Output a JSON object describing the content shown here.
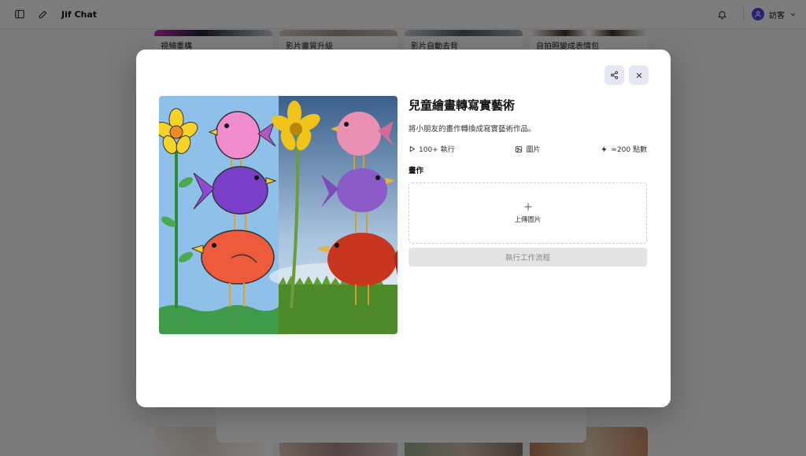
{
  "app": {
    "brand": "Jif Chat",
    "user_name": "訪客"
  },
  "background_cards": [
    "視頻重構",
    "影片畫質升級",
    "影片自動去背",
    "自拍照變成表情包"
  ],
  "modal": {
    "title": "兒童繪畫轉寫實藝術",
    "description": "將小朋友的畫作轉換成寫實藝術作品。",
    "meta": {
      "runs": "100+ 執行",
      "type": "圖片",
      "cost": "≈200 點數"
    },
    "field_label": "畫作",
    "upload_label": "上傳圖片",
    "run_button": "執行工作流程"
  },
  "icons": {
    "sidebar": "sidebar-toggle-icon",
    "new_chat": "edit-icon",
    "bell": "bell-icon",
    "share": "share-icon",
    "close": "close-icon",
    "play": "play-icon",
    "image": "image-icon",
    "bolt": "bolt-icon",
    "plus": "plus-icon"
  },
  "colors": {
    "accent": "#4f46e5",
    "icon_button_bg": "#e5e7f5",
    "disabled_button": "#e4e4e4"
  }
}
